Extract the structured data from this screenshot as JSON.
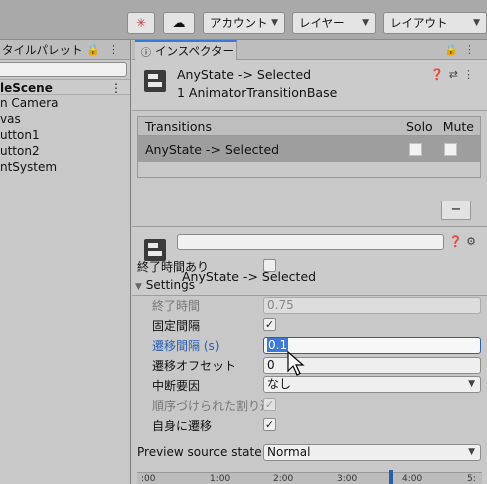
{
  "toolbar": {
    "account_label": "アカウント",
    "layers_label": "レイヤー",
    "layout_label": "レイアウト"
  },
  "left_panel": {
    "tab_label": "タイルパレット",
    "scene_name": "leScene",
    "items": [
      "n Camera",
      "vas",
      "utton1",
      "utton2",
      "ntSystem"
    ]
  },
  "inspector": {
    "tab_label": "インスペクター",
    "title": "AnyState -> Selected",
    "subtitle": "1 AnimatorTransitionBase",
    "transitions_header": "Transitions",
    "solo_label": "Solo",
    "mute_label": "Mute",
    "transition_row": "AnyState -> Selected",
    "minus_label": "−",
    "name_value": "",
    "section_title": "AnyState -> Selected",
    "props": {
      "has_exit_time": "終了時間あり",
      "settings": "Settings",
      "exit_time": "終了時間",
      "exit_time_value": "0.75",
      "fixed_duration": "固定間隔",
      "transition_duration": "遷移間隔 (s)",
      "transition_duration_value": "0.1",
      "transition_offset": "遷移オフセット",
      "transition_offset_value": "0",
      "interruption_source": "中断要因",
      "interruption_source_value": "なし",
      "ordered_interruption": "順序づけられた割り込み",
      "can_transition_to_self": "自身に遷移",
      "preview_source_state": "Preview source state",
      "preview_source_state_value": "Normal"
    },
    "timeline_labels": [
      ":00",
      "1:00",
      "2:00",
      "3:00",
      "4:00",
      "5:"
    ]
  }
}
